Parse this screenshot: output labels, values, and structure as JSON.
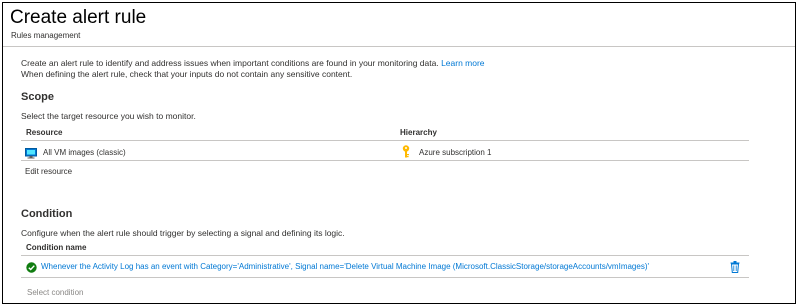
{
  "header": {
    "title": "Create alert rule",
    "subtitle": "Rules management"
  },
  "intro": {
    "line1": "Create an alert rule to identify and address issues when important conditions are found in your monitoring data.",
    "learn_more": "Learn more",
    "line2": "When defining the alert rule, check that your inputs do not contain any sensitive content."
  },
  "scope": {
    "heading": "Scope",
    "description": "Select the target resource you wish to monitor.",
    "columns": [
      "Resource",
      "Hierarchy"
    ],
    "resource_name": "All VM images (classic)",
    "resource_icon": "vm-image-icon",
    "hierarchy_name": "Azure subscription 1",
    "hierarchy_icon": "key-icon",
    "edit_link": "Edit resource"
  },
  "condition": {
    "heading": "Condition",
    "description": "Configure when the alert rule should trigger by selecting a signal and defining its logic.",
    "column": "Condition name",
    "status_icon": "check-circle-icon",
    "condition_text": "Whenever the Activity Log has an event with Category='Administrative', Signal name='Delete Virtual Machine Image (Microsoft.ClassicStorage/storageAccounts/vmImages)'",
    "delete_icon": "trash-icon",
    "select_placeholder": "Select condition"
  },
  "colors": {
    "accent": "#0078d4",
    "success": "#107c10",
    "key": "#ffb900",
    "text": "#323130",
    "muted": "#8a8886"
  }
}
